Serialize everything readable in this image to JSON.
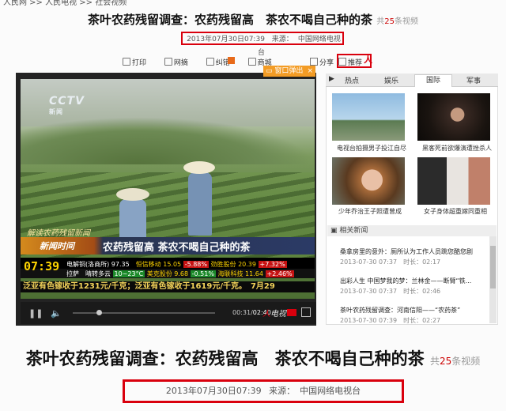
{
  "breadcrumb": "人民网 >> 人民电视 >> 社会视频",
  "article": {
    "title": "茶叶农药残留调查：农药残留高　茶农不喝自己种的茶",
    "count_prefix": "共",
    "count": "25",
    "count_suffix": "条视频",
    "date": "2013年07月30日07:39",
    "source_label": "来源：",
    "source": "中国网络电视台"
  },
  "toolbar": {
    "print": "打印",
    "email": "网摘",
    "correction": "纠错",
    "mall": "商城",
    "share": "分享",
    "recommend": "推荐"
  },
  "player": {
    "popout_label": "窗口弹出",
    "close": "×",
    "logo": "CCTV",
    "logo_sub": "新闻",
    "show_title": "解读农药残留新闻",
    "show_tag": "新闻时间",
    "headline": "农药残留高 茶农不喝自己种的茶",
    "clock": "07:39",
    "ticker1": "电解铜(洛商所) 97.35",
    "ticker2": "恒信移动 15.05",
    "ticker3": "-5.88%",
    "ticker4": "劲胜股份 20.39",
    "ticker5": "+7.32%",
    "ticker6": "拉萨　晴转多云",
    "ticker7": "10~23°C",
    "ticker8": "美克股份 9.68",
    "ticker9": "-0.51%",
    "ticker10": "海联科技 11.64",
    "ticker11": "+2.46%",
    "news": "泛亚有色镓收于1231元/千克；泛亚有色镓收于1619元/千克。　7月29",
    "current_time": "00:31",
    "total_time": "02:40",
    "brand": "人民电视"
  },
  "right_panel": {
    "tabs": [
      "热点",
      "娱乐",
      "国际",
      "军事"
    ],
    "active_tab": "国际",
    "thumbs": [
      {
        "caption": "电视台拍摄男子投江自尽"
      },
      {
        "caption": "黑客死前欲爆演遭挫杀人"
      },
      {
        "caption": "少年乔治王子照遭曾成"
      },
      {
        "caption": "女子身体超重嫁同重相"
      }
    ],
    "related_title": "相关新闻",
    "related": [
      {
        "title": "桑拿房里的意外：厕所认为工作人员跳您酷您剧",
        "date": "2013-07-30 07:37",
        "duration_label": "时长：",
        "duration": "02:17"
      },
      {
        "title": "出彩人生 中国梦我的梦：兰林金——断臂“铁...",
        "date": "2013-07-30 07:37",
        "duration_label": "时长：",
        "duration": "02:46"
      },
      {
        "title": "茶叶农药残留调查：河南信阳——“农药茶”",
        "date": "2013-07-30 07:39",
        "duration_label": "时长：",
        "duration": "02:27"
      }
    ]
  }
}
